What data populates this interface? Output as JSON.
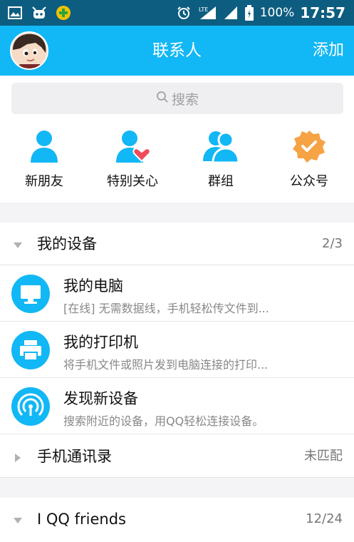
{
  "status": {
    "left_icons": [
      "image-icon",
      "bot-icon",
      "plus-badge-icon"
    ],
    "lte": "LTE",
    "battery": "100%",
    "time": "17:57"
  },
  "header": {
    "title": "联系人",
    "add": "添加"
  },
  "search": {
    "placeholder": "搜索"
  },
  "quick": [
    {
      "label": "新朋友",
      "icon": "person-icon"
    },
    {
      "label": "特别关心",
      "icon": "person-heart-icon"
    },
    {
      "label": "群组",
      "icon": "group-icon"
    },
    {
      "label": "公众号",
      "icon": "badge-check-icon"
    }
  ],
  "groups": {
    "devices": {
      "title": "我的设备",
      "count": "2/3"
    },
    "phone": {
      "title": "手机通讯录",
      "count": "未匹配"
    },
    "friends": {
      "title": "I QQ friends",
      "count": "12/24"
    }
  },
  "devices": [
    {
      "name": "我的电脑",
      "desc": "[在线] 无需数据线，手机轻松传文件到...",
      "icon": "monitor-icon"
    },
    {
      "name": "我的打印机",
      "desc": "将手机文件或照片发到电脑连接的打印...",
      "icon": "printer-icon"
    },
    {
      "name": "发现新设备",
      "desc": "搜索附近的设备，用QQ轻松连接设备。",
      "icon": "radar-icon"
    }
  ],
  "colors": {
    "accent": "#12b7f5",
    "statusbar": "#0d5d80",
    "heart": "#f04b5a",
    "badge": "#f5a345"
  }
}
